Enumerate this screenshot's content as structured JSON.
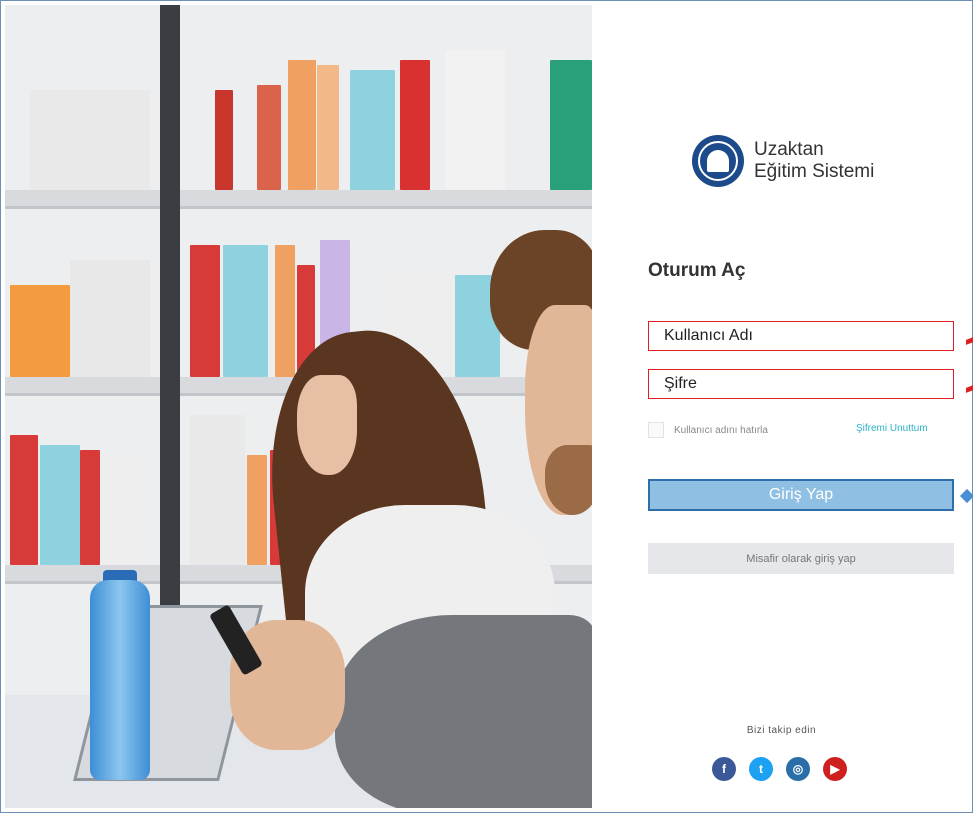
{
  "brand": {
    "line1": "Uzaktan",
    "line2": "Eğitim Sistemi",
    "logo_icon": "university-seal-icon",
    "seal_color": "#1c4a8a"
  },
  "login": {
    "heading": "Oturum Aç",
    "username_placeholder": "Kullanıcı Adı",
    "password_placeholder": "Şifre",
    "remember_label": "Kullanıcı adını hatırla",
    "forgot_label": "Şifremi Unuttum",
    "submit_label": "Giriş Yap",
    "guest_label": "Misafir olarak giriş yap"
  },
  "social": {
    "label": "Bizi takip edin",
    "items": [
      {
        "name": "facebook-icon",
        "glyph": "f",
        "color": "#3b5998"
      },
      {
        "name": "twitter-icon",
        "glyph": "t",
        "color": "#1da1f2"
      },
      {
        "name": "instagram-icon",
        "glyph": "◎",
        "color": "#2a6ea8"
      },
      {
        "name": "youtube-icon",
        "glyph": "▶",
        "color": "#cd201f"
      }
    ]
  },
  "colors": {
    "annotation_red": "#e02020",
    "primary_button": "#8fbfe3",
    "link": "#2bb3c6"
  }
}
